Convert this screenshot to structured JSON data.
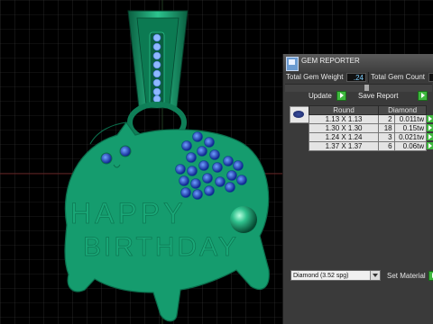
{
  "model": {
    "text_line1": "HAPPY",
    "text_line2": "BIRTHDAY",
    "colors": {
      "metal": "#159c6e",
      "metal_dark": "#0b6e4c",
      "gem": "#1d3fbf",
      "grid": "#3a3a3a",
      "background": "#000000"
    }
  },
  "panel": {
    "title": "GEM REPORTER",
    "total_weight_label": "Total Gem Weight",
    "total_weight_value": ".24",
    "total_count_label": "Total Gem Count",
    "update_label": "Update",
    "save_report_label": "Save Report",
    "col_round": "Round",
    "col_diamond": "Diamond",
    "rows": [
      {
        "size": "1.13 X 1.13",
        "count": "2",
        "weight": "0.011tw"
      },
      {
        "size": "1.30 X 1.30",
        "count": "18",
        "weight": "0.15tw"
      },
      {
        "size": "1.24 X 1.24",
        "count": "3",
        "weight": "0.021tw"
      },
      {
        "size": "1.37 X 1.37",
        "count": "6",
        "weight": "0.06tw"
      }
    ],
    "material_select": "Diamond     (3.52 spg)",
    "set_material_label": "Set Material"
  }
}
